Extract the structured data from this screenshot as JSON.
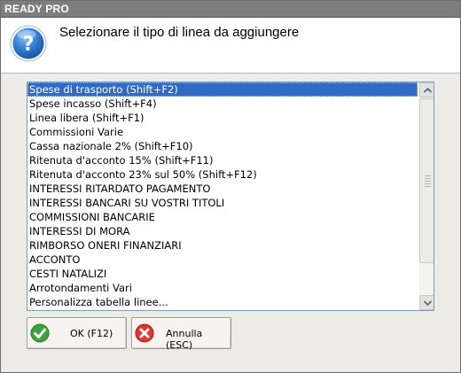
{
  "window": {
    "title": "READY PRO"
  },
  "header": {
    "prompt": "Selezionare il tipo di linea da aggiungere",
    "icon": "question-icon"
  },
  "list": {
    "selected_index": 0,
    "items": [
      "Spese di trasporto (Shift+F2)",
      "Spese incasso (Shift+F4)",
      "Linea libera (Shift+F1)",
      "Commissioni Varie",
      "Cassa nazionale 2% (Shift+F10)",
      "Ritenuta d'acconto 15% (Shift+F11)",
      "Ritenuta d'acconto 23% sul 50% (Shift+F12)",
      "INTERESSI RITARDATO PAGAMENTO",
      "INTERESSI BANCARI SU VOSTRI TITOLI",
      "COMMISSIONI BANCARIE",
      "INTERESSI DI MORA",
      "RIMBORSO ONERI FINANZIARI",
      "ACCONTO",
      "CESTI NATALIZI",
      "Arrotondamenti Vari",
      "Personalizza tabella linee..."
    ]
  },
  "buttons": {
    "ok": {
      "label": "OK (F12)",
      "icon": "checkmark-icon"
    },
    "cancel": {
      "label": "Annulla (ESC)",
      "icon": "close-icon"
    }
  },
  "colors": {
    "selection": "#316ac5",
    "titlebar": "#7d7d7d",
    "dialog_bg": "#ecebe6"
  }
}
